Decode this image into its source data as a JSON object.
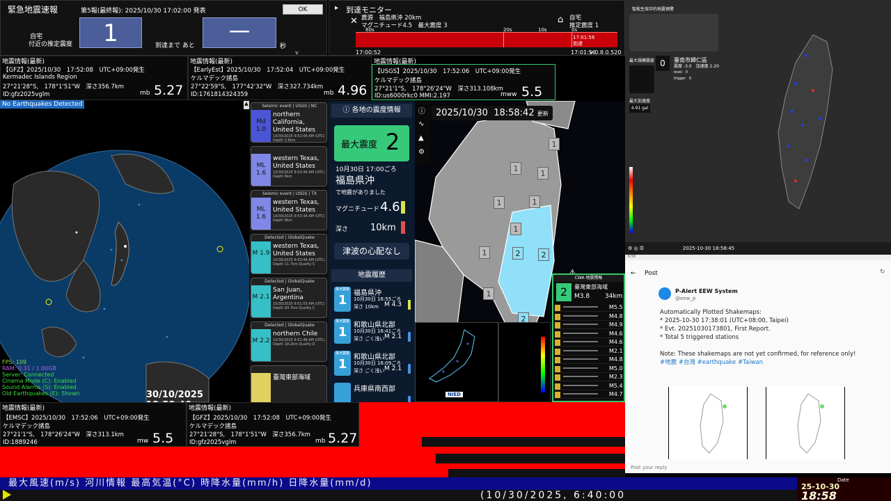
{
  "eew": {
    "title": "緊急地震速報",
    "issue": "第5報(最終報): 2025/10/30 17:02:00 発表",
    "ok": "OK",
    "home_line1": "自宅",
    "home_line2": "付近の推定震度",
    "intensity": "1",
    "arrive_label": "到達まで あと",
    "remain": "一",
    "sec": "秒",
    "version": "v 0.8.0.520"
  },
  "monitor": {
    "title": "到達モニター",
    "close": "✕",
    "quake_line1": "震源　福島県沖 20km",
    "quake_line2": "マグニチュード4.5　最大震度 3",
    "home_line1": "自宅",
    "home_line2": "推定震度 1",
    "ticks": [
      "60s",
      "20s",
      "10s",
      "0s"
    ],
    "arrive_time": "17:01:56",
    "arrive_label": "到達",
    "time_left": "17:00:52",
    "time_right": "17:01:56",
    "version": "v 0.8.0.520"
  },
  "info_gfz_top": {
    "header": "地震情報(最新)",
    "line1": "【GFZ】2025/10/30　17:52:08　UTC+09:00発生",
    "line2": "Kermadec Islands Region",
    "line3": "27°21'28\"S,　178°1'51\"W　深さ356.7km",
    "line4": "ID:gfz2025vglm",
    "mtype": "mb",
    "mag": "5.27"
  },
  "info_early": {
    "header": "地震情報(最新)",
    "line1": "【EarlyEst】2025/10/30　17:52:04　UTC+09:00発生",
    "line2": "ケルマデック諸島",
    "line3": "27°22'59\"S,　177°42'32\"W　深さ327.734km",
    "line4": "ID:1761814324359",
    "mtype": "mb",
    "mag": "4.96"
  },
  "info_usgs": {
    "header": "地震情報(最新)",
    "line1": "【USGS】2025/10/30　17:52:06　UTC+09:00発生",
    "line2": "ケルマデック諸島",
    "line3": "27°21'1\"S,　178°26'24\"W　深さ313.108km",
    "line4": "ID:us6000rkc0 MMI:2.197",
    "mtype": "mww",
    "mag": "5.5"
  },
  "info_emsc": {
    "header": "地震情報(最新)",
    "line1": "【EMSC】2025/10/30　17:52:06　UTC+09:00発生",
    "line2": "ケルマデック諸島",
    "line3": "27°21'1\"S,　178°26'24\"W　深さ313.1km",
    "line4": "ID:1889246",
    "mtype": "mw",
    "mag": "5.5"
  },
  "info_gfz_bottom": {
    "header": "地震情報(最新)",
    "line1": "【GFZ】2025/10/30　17:52:08　UTC+09:00発生",
    "line2": "ケルマデック諸島",
    "line3": "27°21'28\"S,　178°1'51\"W　深さ356.7km",
    "line4": "ID:gfz2025vglm",
    "mtype": "mb",
    "mag": "5.27"
  },
  "globe": {
    "status": "No Earthquakes Detected",
    "stats": [
      "FPS: 109",
      "RAM: 0.31 / 1.00GB",
      "Server: Connected",
      "Cinema Mode (C): Enabled",
      "Sound Alarms (S): Enabled",
      "Old Earthquakes (E): Shown"
    ],
    "timestamp": "30/10/2025 18:58:46"
  },
  "seismic_list": [
    {
      "cap": "Seismic event | USGS | NC",
      "side": "Md 1.0",
      "place": "northern California, United States",
      "meta": "10/30/2025 9:52:06 AM (UTC) Depth 2.6km",
      "color": "#4a55d6"
    },
    {
      "cap": "",
      "side": "ML 1.6",
      "place": "western Texas, United States",
      "meta": "10/30/2025 9:53:44 AM (UTC) Depth 6km",
      "color": "#7f88e6"
    },
    {
      "cap": "Seismic event | USGS | TX",
      "side": "ML 1.6",
      "place": "western Texas, United States",
      "meta": "10/30/2025 9:53:34 AM (UTC) Depth 8km",
      "color": "#7f88e6"
    },
    {
      "cap": "Detected | GlobalQuake",
      "side": "M 1.9",
      "place": "western Texas, United States",
      "meta": "10/30/2025 9:53:44 AM (UTC) Depth 11.7km Quality S",
      "color": "#35c0c8"
    },
    {
      "cap": "Detected | GlobalQuake",
      "side": "M 2.1",
      "place": "San Juan, Argentina",
      "meta": "10/30/2025 9:51:53 AM (UTC) Depth 93.7km Quality C",
      "color": "#35c0c8"
    },
    {
      "cap": "Detected | GlobalQuake",
      "side": "M 2.2",
      "place": "northern Chile",
      "meta": "10/30/2025 9:51:48 AM (UTC) Depth 18.2km Quality D",
      "color": "#35c0c8"
    },
    {
      "cap": "",
      "side": "",
      "place": "臺灣東部海域",
      "meta": "",
      "color": "#e0d060"
    }
  ],
  "jp": {
    "header": "各地の震度情報",
    "max_label": "最大震度",
    "max_value": "2",
    "date": "10月30日 17:00ごろ",
    "area": "福島県沖",
    "occurred": "で地震がありました",
    "mag_label": "マグニチュード",
    "mag_value": "4.6",
    "depth_label": "深さ",
    "depth_value": "10km",
    "tsunami": "津波の心配なし",
    "history_title": "地震履歴",
    "history": [
      {
        "int": "1",
        "tag": "最大震度",
        "place": "福島県沖",
        "date": "10月30日 16:55ごろ",
        "depth": "深さ 10km",
        "mag": "M 4.3",
        "color": "#d8e24a"
      },
      {
        "int": "1",
        "tag": "最大震度",
        "place": "和歌山県北部",
        "date": "10月30日 16:41ごろ",
        "depth": "深さ ごく浅い",
        "mag": "M 2.1",
        "color": "#4a90e2"
      },
      {
        "int": "1",
        "tag": "最大震度",
        "place": "和歌山県北部",
        "date": "10月30日 16:09ごろ",
        "depth": "深さ ごく浅い",
        "mag": "M 2.1",
        "color": "#4a90e2"
      },
      {
        "int": "",
        "tag": "",
        "place": "兵庫県南西部",
        "date": "",
        "depth": "",
        "mag": "",
        "color": "#4a90e2"
      }
    ]
  },
  "jpmap": {
    "clock_date": "2025/10/30",
    "clock_time": "18:58:42",
    "clock_suffix": "更新",
    "icons": [
      "info-icon",
      "wave-icon",
      "warning-icon",
      "gear-icon"
    ],
    "cwa_title": "CWA 地震情報",
    "cwa_int": "2",
    "cwa_place": "臺灣東部海域",
    "cwa_mag": "M3.8",
    "cwa_depth": "34km",
    "cwa_list": [
      "M5.5",
      "M4.8",
      "M4.9",
      "M4.6",
      "M4.6",
      "M2.1",
      "M4.8",
      "M5.0",
      "M2.3",
      "M5.4",
      "M4.7"
    ],
    "nied": "NIED"
  },
  "taiwan": {
    "warn_title": "智能生效中的地震預警",
    "max_int_label": "最大規模震度",
    "int": "0",
    "loc_line1": "臺南市歸仁區",
    "loc_line2": "震度 -3.0　加速度 2.20",
    "level": "level　0",
    "trigger": "trigger　0",
    "max_acc_label": "最大加速度",
    "acc": "4.91 gal",
    "toolbar_time": "2025-10-30 18:58:45"
  },
  "post": {
    "statusbar": "6:58",
    "title": "Post",
    "name": "P-Alert EEW System",
    "handle": "@eew_p",
    "lines": [
      "Automatically Plotted Shakemaps:",
      "* 2025-10-30 17:38:01 (UTC+08:00, Taipei)",
      "* Evt. 20251030173801, First Report.",
      "* Total 5 triggered stations",
      "",
      "Note: These shakemaps are not yet confirmed, for reference only!"
    ],
    "tags": "#地震 #台灣 #earthquake #Taiwan",
    "reply": "Post your reply"
  },
  "ticker": {
    "row1": "最大風速(m/s)  河川情報      最高気温(°C)    時降水量(mm/h)   日降水量(mm/d)",
    "row2": "(10/30/2025, 6:40:00"
  },
  "datetime": {
    "label": "Date",
    "date": "25-10-30",
    "time": "18:58"
  }
}
